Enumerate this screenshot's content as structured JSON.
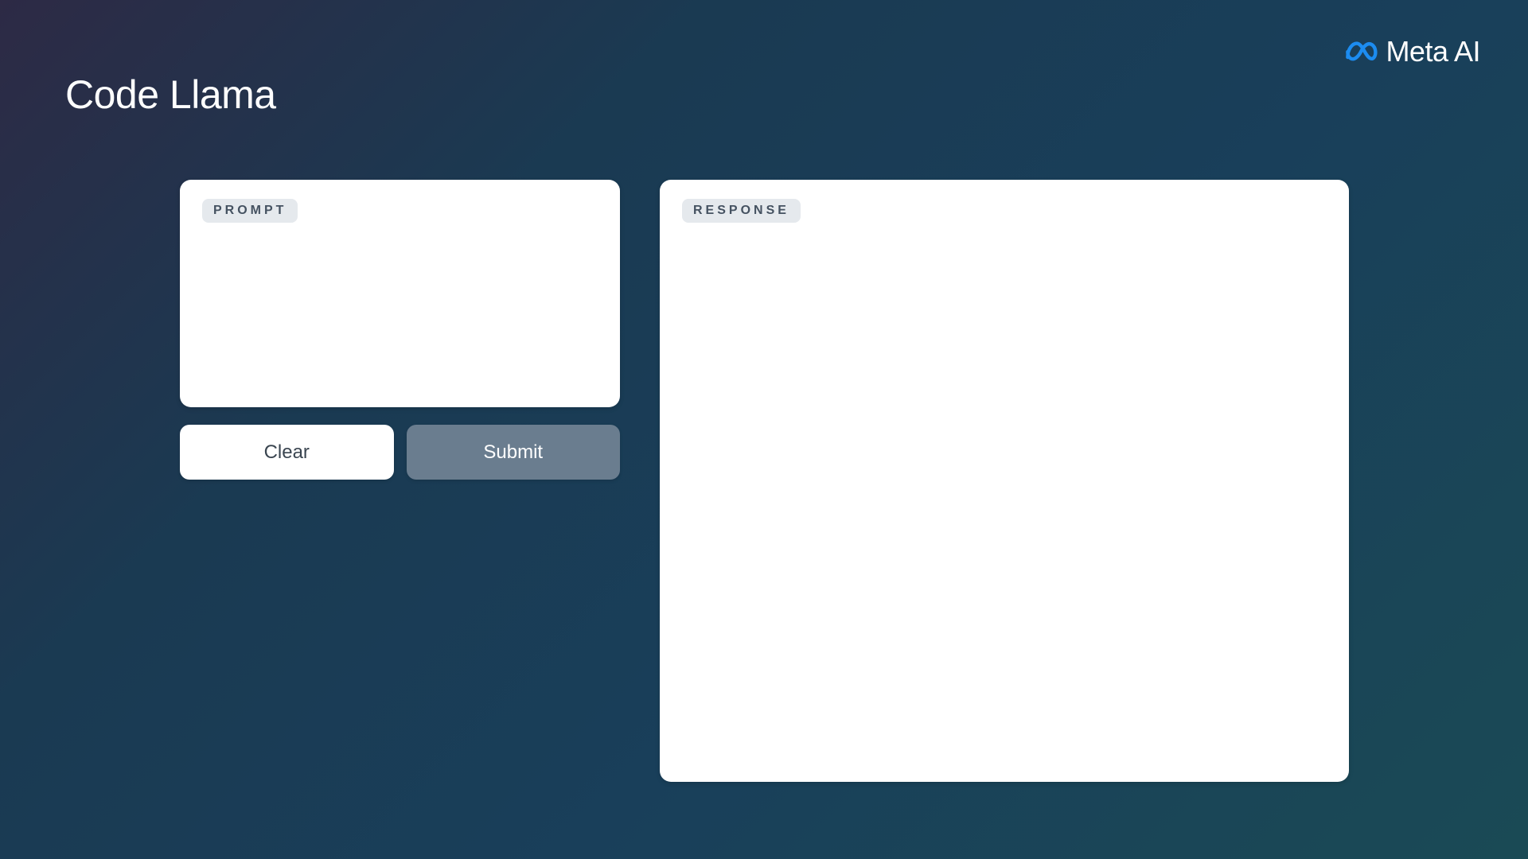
{
  "header": {
    "title": "Code Llama",
    "brand_text": "Meta AI"
  },
  "prompt_panel": {
    "label": "PROMPT",
    "value": ""
  },
  "response_panel": {
    "label": "RESPONSE",
    "content": ""
  },
  "buttons": {
    "clear_label": "Clear",
    "submit_label": "Submit"
  }
}
